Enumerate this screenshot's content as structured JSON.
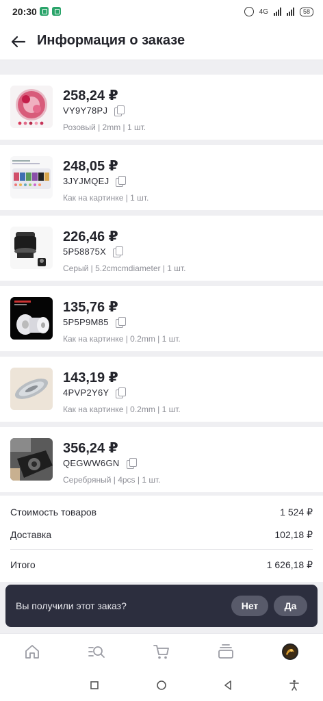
{
  "status": {
    "time": "20:30",
    "network": "4G",
    "battery": "58"
  },
  "header": {
    "title": "Информация о заказе"
  },
  "items": [
    {
      "price": "258,24 ₽",
      "code": "VY9Y78PJ",
      "variant": "Розовый | 2mm | 1 шт."
    },
    {
      "price": "248,05 ₽",
      "code": "3JYJMQEJ",
      "variant": "Как на картинке | 1 шт."
    },
    {
      "price": "226,46 ₽",
      "code": "5P58875X",
      "variant": "Серый | 5.2cmcmdiameter | 1 шт."
    },
    {
      "price": "135,76 ₽",
      "code": "5P5P9M85",
      "variant": "Как на картинке | 0.2mm | 1 шт."
    },
    {
      "price": "143,19 ₽",
      "code": "4PVP2Y6Y",
      "variant": "Как на картинке | 0.2mm | 1 шт."
    },
    {
      "price": "356,24 ₽",
      "code": "QEGWW6GN",
      "variant": "Серебряный | 4pcs | 1 шт."
    }
  ],
  "summary": {
    "goods_label": "Стоимость товаров",
    "goods_value": "1 524 ₽",
    "delivery_label": "Доставка",
    "delivery_value": "102,18 ₽",
    "total_label": "Итого",
    "total_value": "1 626,18 ₽"
  },
  "received": {
    "question": "Вы получили этот заказ?",
    "no_label": "Нет",
    "yes_label": "Да"
  },
  "nav": [
    "home-icon",
    "search-catalog-icon",
    "cart-icon",
    "orders-icon",
    "profile-avatar"
  ],
  "colors": {
    "dark_bar": "#2c2e3e",
    "pill": "#585a6a",
    "background": "#efeff2"
  }
}
